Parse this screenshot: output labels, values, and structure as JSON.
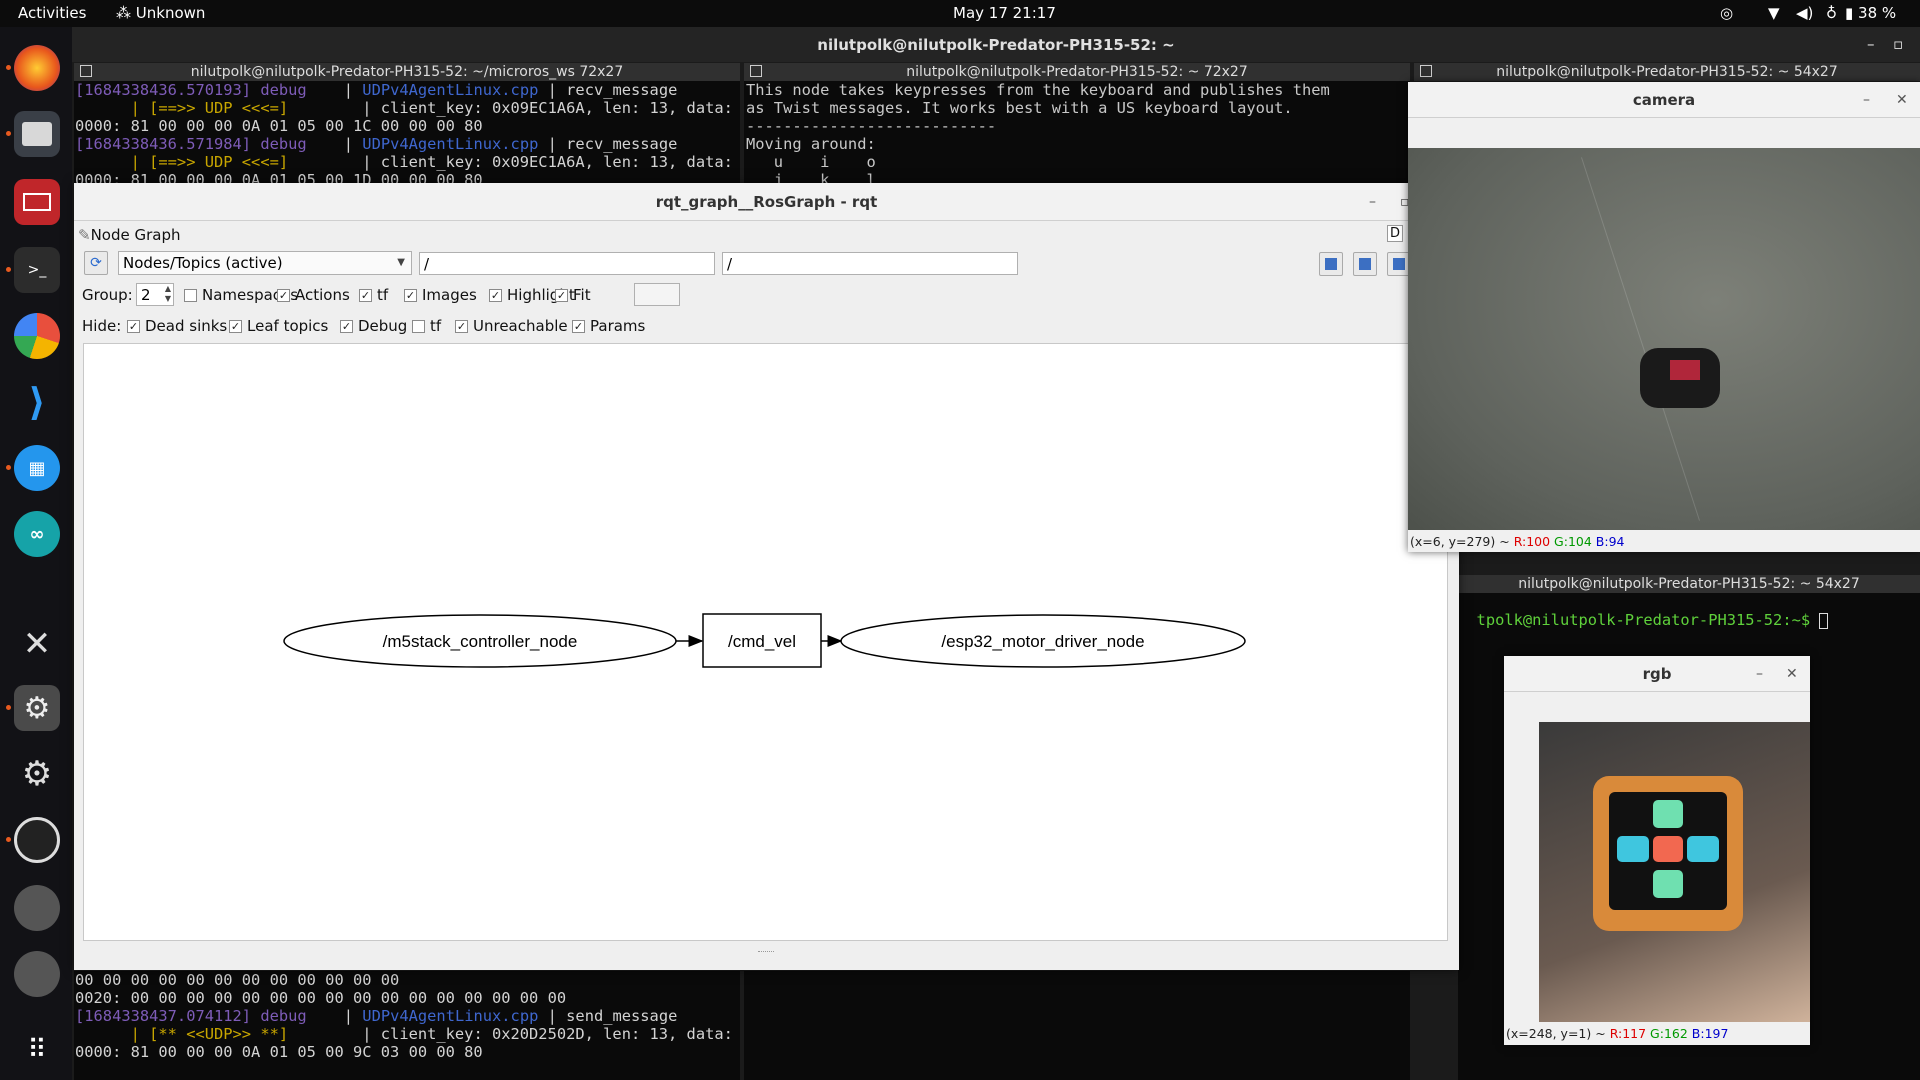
{
  "topbar": {
    "activities": "Activities",
    "app": "Unknown",
    "clock": "May 17  21:17",
    "battery": "38 %"
  },
  "dock": {
    "items": [
      "firefox-icon",
      "files-icon",
      "presenter-icon",
      "terminal-icon",
      "pie-app-icon",
      "vscode-icon",
      "docker-icon",
      "arduino-icon",
      "tools-icon",
      "settings-icon",
      "settings-alt-icon",
      "obs-icon",
      "disc-icon",
      "disc-icon",
      "apps-grid-icon"
    ]
  },
  "main_title": "nilutpolk@nilutpolk-Predator-PH315-52: ~",
  "term1": {
    "title": "nilutpolk@nilutpolk-Predator-PH315-52: ~/microros_ws 72x27",
    "lines": [
      {
        "num": "[1684338436.570193]",
        "lvl": "debug",
        "sep": "    | ",
        "file": "UDPv4AgentLinux.cpp",
        "rest": " | recv_message"
      },
      {
        "udp": "      | [==>> UDP <<<=]",
        "rest": "        | client_key: 0x09EC1A6A, len: 13, data:"
      },
      {
        "plain": "0000: 81 00 00 00 0A 01 05 00 1C 00 00 00 80"
      },
      {
        "num": "[1684338436.571984]",
        "lvl": "debug",
        "sep": "    | ",
        "file": "UDPv4AgentLinux.cpp",
        "rest": " | recv_message"
      },
      {
        "udp": "      | [==>> UDP <<<=]",
        "rest": "        | client_key: 0x09EC1A6A, len: 13, data:"
      },
      {
        "plain": "0000: 81 00 00 00 0A 01 05 00 1D 00 00 00 80"
      }
    ],
    "bottom": [
      {
        "plain": "00 00 00 00 00 00 00 00 00 00 00 00"
      },
      {
        "plain": "0020: 00 00 00 00 00 00 00 00 00 00 00 00 00 00 00 00"
      },
      {
        "num": "[1684338437.074112]",
        "lvl": "debug",
        "sep": "    | ",
        "file": "UDPv4AgentLinux.cpp",
        "rest": " | send_message"
      },
      {
        "udp": "      | [** <<UDP>> **]",
        "rest": "        | client_key: 0x20D2502D, len: 13, data:"
      },
      {
        "plain": "0000: 81 00 00 00 0A 01 05 00 9C 03 00 00 80"
      }
    ]
  },
  "term2": {
    "title": "nilutpolk@nilutpolk-Predator-PH315-52: ~ 72x27",
    "lines": [
      "This node takes keypresses from the keyboard and publishes them",
      "as Twist messages. It works best with a US keyboard layout.",
      "---------------------------",
      "Moving around:",
      "   u    i    o",
      "   j    k    l"
    ]
  },
  "term3": {
    "title": "nilutpolk@nilutpolk-Predator-PH315-52: ~ 54x27"
  },
  "term4": {
    "title": "nilutpolk@nilutpolk-Predator-PH315-52: ~ 54x27",
    "prompt": "tpolk@nilutpolk-Predator-PH315-52:~$ "
  },
  "rqt": {
    "title": "rqt_graph__RosGraph - rqt",
    "plugin": "Node Graph",
    "dropdown": "Nodes/Topics (active)",
    "filter1": "/",
    "filter2": "/",
    "group_label": "Group:",
    "group_value": "2",
    "row1": [
      {
        "label": "Namespaces",
        "checked": false
      },
      {
        "label": "Actions",
        "checked": true
      },
      {
        "label": "tf",
        "checked": true
      },
      {
        "label": "Images",
        "checked": true
      },
      {
        "label": "Highlight",
        "checked": true
      },
      {
        "label": "Fit",
        "checked": true
      }
    ],
    "hide_label": "Hide:",
    "row2": [
      {
        "label": "Dead sinks",
        "checked": true
      },
      {
        "label": "Leaf topics",
        "checked": true
      },
      {
        "label": "Debug",
        "checked": true
      },
      {
        "label": "tf",
        "checked": false
      },
      {
        "label": "Unreachable",
        "checked": true
      },
      {
        "label": "Params",
        "checked": true
      }
    ],
    "graph": {
      "node_a": "/m5stack_controller_node",
      "topic": "/cmd_vel",
      "node_b": "/esp32_motor_driver_node"
    }
  },
  "camera": {
    "title": "camera",
    "status_prefix": "(x=6, y=279) ~ ",
    "r": "R:100",
    "g": "G:104",
    "b": "B:94"
  },
  "rgb": {
    "title": "rgb",
    "status_prefix": "(x=248, y=1) ~ ",
    "r": "R:117",
    "g": "G:162",
    "b": "B:197"
  },
  "colors": {
    "accent": "#e85a1f",
    "term_bg": "#0a0a0a",
    "num": "#7e5cb8",
    "file": "#3f67cf",
    "udp": "#c8a600"
  }
}
